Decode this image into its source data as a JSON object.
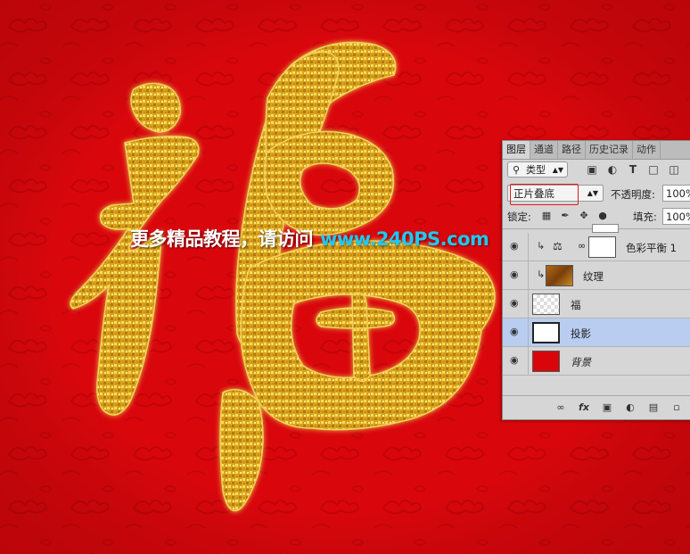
{
  "watermark": {
    "text_cn": "更多精品教程，请访问",
    "text_url": "www.240PS.com"
  },
  "panel": {
    "tabs": [
      "图层",
      "通道",
      "路径",
      "历史记录",
      "动作"
    ],
    "kind_filter": "类型",
    "blend_mode": "正片叠底",
    "opacity_label": "不透明度:",
    "opacity_value": "100%",
    "lock_label": "锁定:",
    "fill_label": "填充:",
    "fill_value": "100%",
    "layers": [
      {
        "name": "色彩平衡 1"
      },
      {
        "name": "纹理"
      },
      {
        "name": "福"
      },
      {
        "name": "投影"
      },
      {
        "name": "背景"
      }
    ]
  },
  "colors": {
    "background_red": "#d8060b",
    "gold": "#e6b622",
    "selection": "#b8cdf0",
    "highlight_box": "#e0191e",
    "watermark_url": "#22c8f0"
  }
}
